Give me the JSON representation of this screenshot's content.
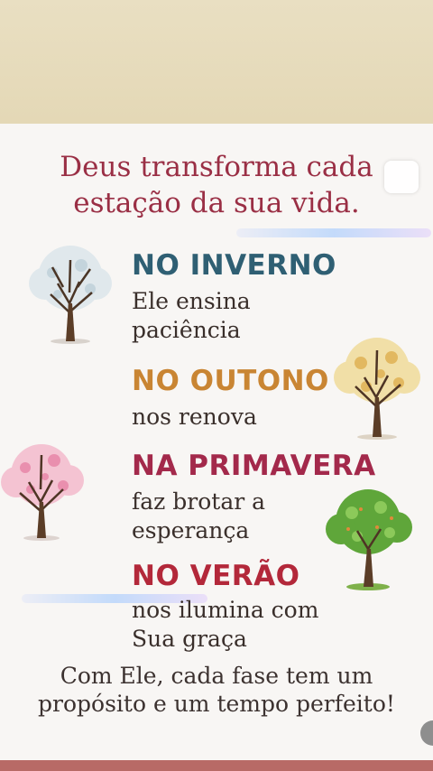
{
  "title": {
    "line1": "Deus transforma cada",
    "line2": "estação da sua vida."
  },
  "seasons": [
    {
      "heading": "NO INVERNO",
      "color": "#2f5f73",
      "lines": [
        "Ele ensina",
        "paciência"
      ],
      "icon": "winter-tree-icon"
    },
    {
      "heading": "NO OUTONO",
      "color": "#c98533",
      "lines": [
        "nos renova"
      ],
      "icon": "autumn-tree-icon"
    },
    {
      "heading": "NA PRIMAVERA",
      "color": "#a3294b",
      "lines": [
        "faz brotar a",
        "esperança"
      ],
      "icon": "spring-tree-icon"
    },
    {
      "heading": "NO VERÃO",
      "color": "#b3283a",
      "lines": [
        "nos ilumina com",
        "Sua graça"
      ],
      "icon": "summer-tree-icon"
    }
  ],
  "closing": {
    "line1": "Com Ele, cada fase tem um",
    "line2": "propósito e um tempo perfeito!"
  },
  "colors": {
    "title": "#9a2f45",
    "body_text": "#3a2f2b",
    "top_band": "#e6dbbb",
    "bottom_band": "#b86a66"
  }
}
